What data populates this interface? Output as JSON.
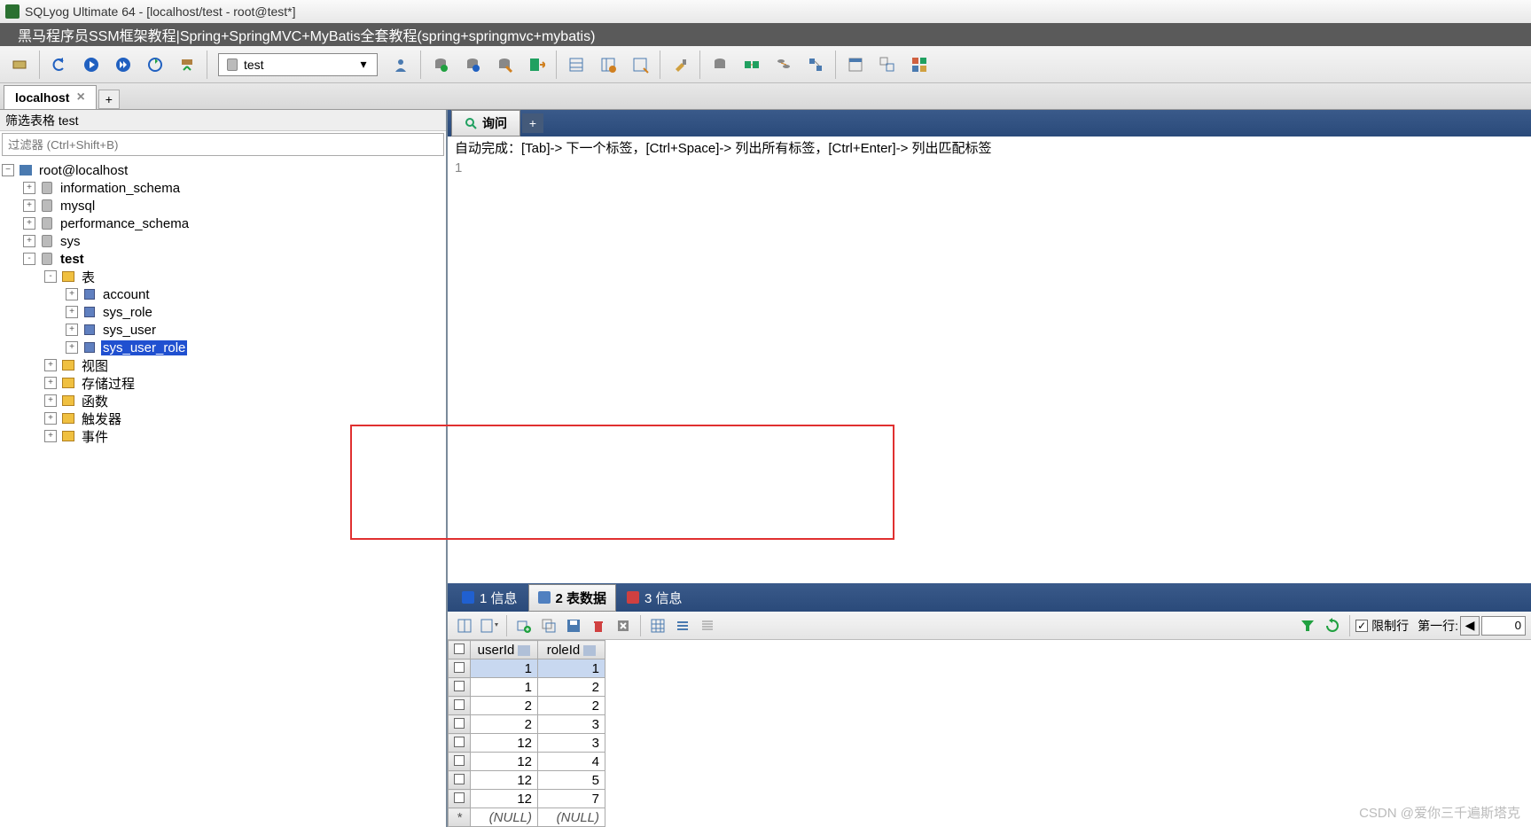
{
  "window": {
    "title": "SQLyog Ultimate 64 - [localhost/test - root@test*]"
  },
  "subtitle": "黑马程序员SSM框架教程|Spring+SpringMVC+MyBatis全套教程(spring+springmvc+mybatis)",
  "toolbar": {
    "db_selector": "test"
  },
  "conn_tab": {
    "label": "localhost",
    "add": "+"
  },
  "filter": {
    "label": "筛选表格 test",
    "placeholder": "过滤器 (Ctrl+Shift+B)"
  },
  "tree": {
    "root": "root@localhost",
    "dbs": [
      {
        "name": "information_schema",
        "expand": "+"
      },
      {
        "name": "mysql",
        "expand": "+"
      },
      {
        "name": "performance_schema",
        "expand": "+"
      },
      {
        "name": "sys",
        "expand": "+"
      },
      {
        "name": "test",
        "expand": "-",
        "bold": true
      }
    ],
    "test_folder_tables": {
      "label": "表",
      "expand": "-"
    },
    "tables": [
      {
        "name": "account",
        "expand": "+"
      },
      {
        "name": "sys_role",
        "expand": "+"
      },
      {
        "name": "sys_user",
        "expand": "+"
      },
      {
        "name": "sys_user_role",
        "expand": "+",
        "selected": true
      }
    ],
    "folders": [
      {
        "name": "视图",
        "expand": "+"
      },
      {
        "name": "存储过程",
        "expand": "+"
      },
      {
        "name": "函数",
        "expand": "+"
      },
      {
        "name": "触发器",
        "expand": "+"
      },
      {
        "name": "事件",
        "expand": "+"
      }
    ]
  },
  "query": {
    "tab_label": "询问",
    "tab_add": "+",
    "hint": "自动完成：[Tab]-> 下一个标签，[Ctrl+Space]-> 列出所有标签，[Ctrl+Enter]-> 列出匹配标签",
    "line1": "1"
  },
  "result_tabs": {
    "t1": "1 信息",
    "t2": "2 表数据",
    "t3": "3 信息"
  },
  "grid_toolbar": {
    "limit_label": "限制行",
    "first_row_label": "第一行:",
    "first_row_value": "0"
  },
  "grid": {
    "columns": [
      "userId",
      "roleId"
    ],
    "rows": [
      {
        "userId": "1",
        "roleId": "1",
        "selected": true
      },
      {
        "userId": "1",
        "roleId": "2"
      },
      {
        "userId": "2",
        "roleId": "2"
      },
      {
        "userId": "2",
        "roleId": "3"
      },
      {
        "userId": "12",
        "roleId": "3"
      },
      {
        "userId": "12",
        "roleId": "4"
      },
      {
        "userId": "12",
        "roleId": "5"
      },
      {
        "userId": "12",
        "roleId": "7"
      }
    ],
    "null_row": {
      "userId": "(NULL)",
      "roleId": "(NULL)",
      "marker": "*"
    }
  },
  "watermark": "CSDN @爱你三千遍斯塔克"
}
